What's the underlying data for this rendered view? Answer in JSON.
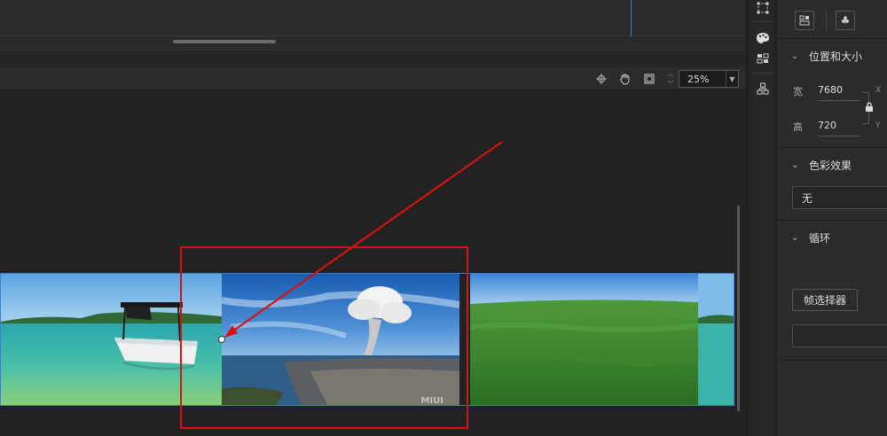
{
  "preview_toolbar": {
    "zoom_value": "25%",
    "zoom_up_glyph": "︿",
    "zoom_down_glyph": "﹀",
    "icons": [
      "crosshair-icon",
      "hand-icon",
      "frame-icon"
    ]
  },
  "strip": {
    "watermark": "MIUI",
    "tiles": [
      {
        "name": "tile-boat-sea",
        "scene": "boat on turquoise sea"
      },
      {
        "name": "tile-volcano-city",
        "scene": "volcano plume over coastal city"
      },
      {
        "name": "tile-green-forest",
        "scene": "green forest under blue sky"
      }
    ]
  },
  "props": {
    "size_section": {
      "title": "位置和大小",
      "width_label": "宽",
      "width_value": "7680",
      "height_label": "高",
      "height_value": "720",
      "x_label": "X",
      "y_label": "Y"
    },
    "color_section": {
      "title": "色彩效果",
      "value": "无"
    },
    "loop_section": {
      "title": "循环",
      "frame_picker_label": "帧选择器"
    }
  },
  "colors": {
    "accent_blue": "#3d7bd6",
    "annotation_red": "#d91010",
    "panel_bg": "#2b2b2b",
    "canvas_bg": "#222222"
  }
}
